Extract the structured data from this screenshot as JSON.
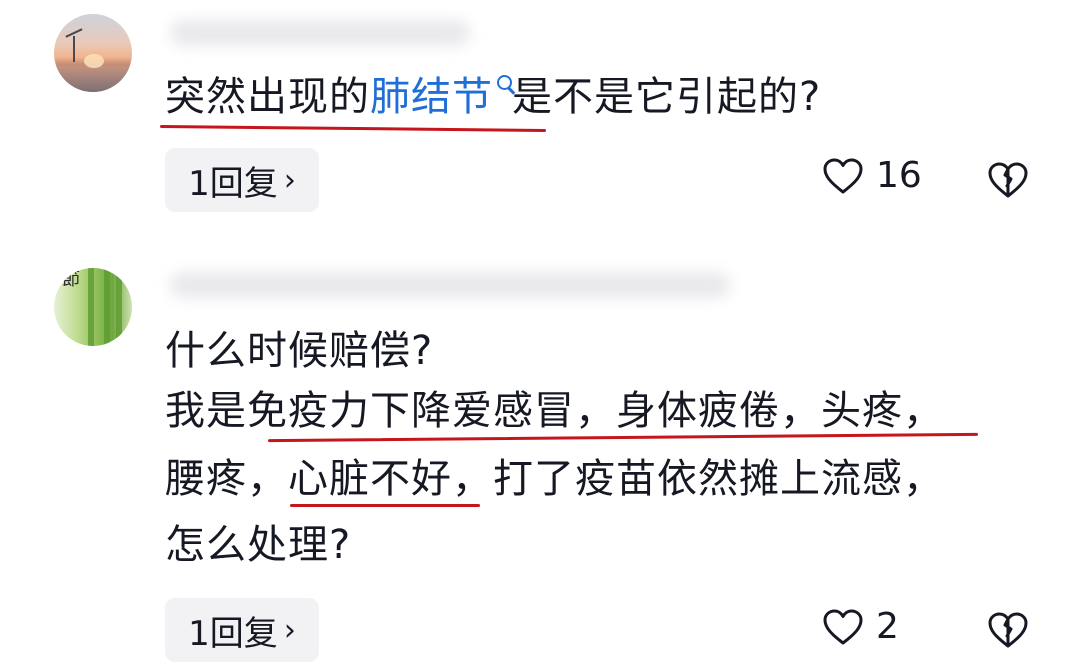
{
  "comments": [
    {
      "text_before": "突然出现的",
      "link_text": "肺结节",
      "text_after": "是不是它引起的?",
      "reply_label": "1回复",
      "likes": "16"
    },
    {
      "lines": [
        "什么时候赔偿?",
        "我是免疫力下降爱感冒，身体疲倦，头疼，",
        "腰疼，心脏不好，打了疫苗依然摊上流感，",
        "怎么处理?"
      ],
      "reply_label": "1回复",
      "likes": "2"
    }
  ],
  "colors": {
    "link": "#1f6fd6",
    "underline_annotation": "#c4161c",
    "reply_bg": "#f2f2f4"
  },
  "icons": {
    "reply_arrow": "chevron-right-icon",
    "like": "heart-outline-icon",
    "dislike": "broken-heart-icon",
    "search": "search-icon"
  }
}
